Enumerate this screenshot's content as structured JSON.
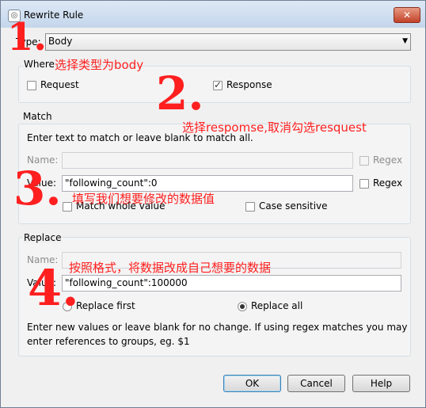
{
  "window": {
    "title": "Rewrite Rule",
    "close_glyph": "✕"
  },
  "type_row": {
    "label": "Type:",
    "selected": "Body"
  },
  "where": {
    "heading": "Where",
    "request_label": "Request",
    "request_checked": false,
    "response_label": "Response",
    "response_checked": true
  },
  "match": {
    "heading": "Match",
    "hint": "Enter text to match or leave blank to match all.",
    "name_label": "Name:",
    "name_value": "",
    "name_regex_label": "Regex",
    "value_label": "Value:",
    "value_value": "\"following_count\":0",
    "value_regex_label": "Regex",
    "whole_value_label": "Match whole value",
    "case_sensitive_label": "Case sensitive"
  },
  "replace": {
    "heading": "Replace",
    "name_label": "Name:",
    "name_value": "",
    "value_label": "Value:",
    "value_value": "\"following_count\":100000",
    "replace_first_label": "Replace first",
    "replace_all_label": "Replace all",
    "selected_mode": "Replace all",
    "hint_line1": "Enter new values or leave blank for no change. If using regex matches you may",
    "hint_line2": "enter references to groups, eg. $1"
  },
  "buttons": {
    "ok": "OK",
    "cancel": "Cancel",
    "help": "Help"
  },
  "annotations": {
    "num1": "1.",
    "note1": "选择类型为body",
    "num2": "2.",
    "note2": "选择respomse,取消勾选resquest",
    "num3": "3.",
    "note3": "填写我们想要修改的数据值",
    "num4": "4.",
    "note4": "按照格式，将数据改成自己想要的数据"
  },
  "colors": {
    "annotation": "#ff1f1f",
    "dialog_bg": "#f0f0f0",
    "title_bar": "#c4d6ec"
  }
}
